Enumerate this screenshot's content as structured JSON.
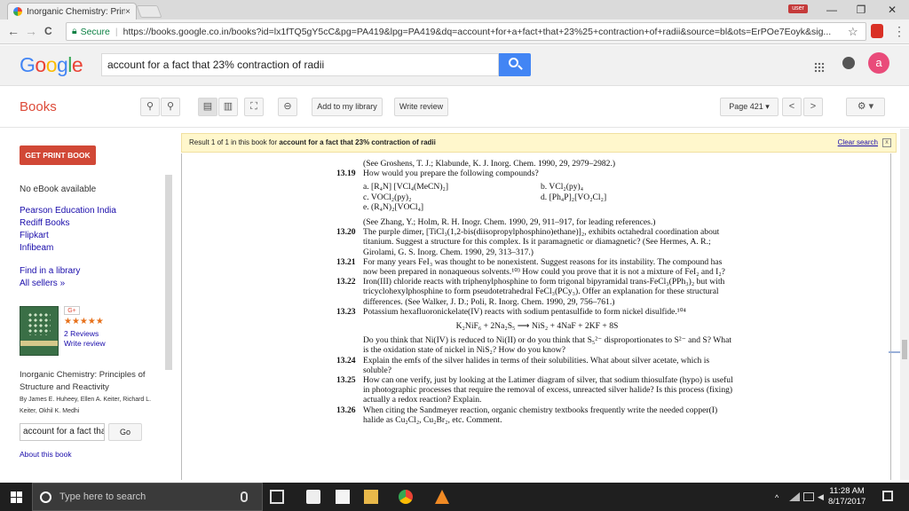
{
  "browser": {
    "tab_title": "Inorganic Chemistry: Prin",
    "tab_close": "×",
    "user_badge": "user",
    "window_controls": {
      "minimize": "—",
      "restore": "❐",
      "close": "✕"
    },
    "secure_label": "Secure",
    "url": "https://books.google.co.in/books?id=lx1fTQ5gY5cC&pg=PA419&lpg=PA419&dq=account+for+a+fact+that+23%25+contraction+of+radii&source=bl&ots=ErPOe7Eoyk&sig...",
    "nav": {
      "back": "←",
      "forward": "→",
      "reload": "C"
    },
    "bookmark_icon": "☆",
    "menu_icon": "⋮"
  },
  "google": {
    "logo_letters": [
      "G",
      "o",
      "o",
      "g",
      "l",
      "e"
    ],
    "logo_colors": [
      "#4285f4",
      "#ea4335",
      "#fbbc05",
      "#4285f4",
      "#34a853",
      "#ea4335"
    ],
    "search_value": "account for a fact that 23% contraction of radii",
    "avatar_letter": "a"
  },
  "books_toolbar": {
    "label": "Books",
    "add_to_library": "Add to my library",
    "write_review": "Write review",
    "page_select": "Page 421 ▾",
    "prev": "<",
    "next": ">",
    "settings": "⚙ ▾"
  },
  "sidebar": {
    "get_print_book": "GET PRINT BOOK",
    "no_ebook": "No eBook available",
    "sellers": [
      "Pearson Education India",
      "Rediff Books",
      "Flipkart",
      "Infibeam"
    ],
    "find_library": "Find in a library",
    "all_sellers": "All sellers »",
    "gplus": "G+",
    "stars": "★★★★★",
    "reviews": "2 Reviews",
    "write_review": "Write review",
    "book_title_1": "Inorganic Chemistry: Principles of",
    "book_title_2": "Structure and Reactivity",
    "authors_1": "By James E. Huheey, Ellen A. Keiter, Richard L.",
    "authors_2": "Keiter, Okhil K. Medhi",
    "search_in_book": "account for a fact tha",
    "go": "Go",
    "about": "About this book"
  },
  "viewer": {
    "result_prefix": "Result 1 of 1 in this book for ",
    "result_query": "account for a fact that 23% contraction of radii",
    "clear_search": "Clear search",
    "clear_x": "x"
  },
  "page": {
    "ref_1": "(See Groshens, T. J.; Klabunde, K. J. Inorg. Chem. 1990, 29, 2979–2982.)",
    "p1319_num": "13.19",
    "p1319": "How would you prepare the following compounds?",
    "parts": [
      "a. [R₄N] [VCl₄(MeCN)₂]",
      "b. VCl₂(py)₄",
      "c. VOCl₂(py)₂",
      "d. [Ph₄P]₂[VO₂Cl₂]",
      "e. (R₄N)₂[VOCl₄]",
      ""
    ],
    "ref_2": "(See Zhang, Y.; Holm, R. H. Inogr. Chem. 1990, 29, 911–917, for leading references.)",
    "p1320_num": "13.20",
    "p1320": "The purple dimer, [TiCl₃(1,2-bis(diisopropylphosphino)ethane)]₂, exhibits octahedral coordination about titanium. Suggest a structure for this complex. Is it paramagnetic or diamagnetic? (See Hermes, A. R.; Girolami, G. S. Inorg. Chem. 1990, 29, 313–317.)",
    "p1321_num": "13.21",
    "p1321": "For many years FeI₃ was thought to be nonexistent. Suggest reasons for its instability. The compound has now been prepared in nonaqueous solvents.¹⁰³ How could you prove that it is not a mixture of FeI₂ and I₂?",
    "p1322_num": "13.22",
    "p1322": "Iron(III) chloride reacts with triphenylphosphine to form trigonal bipyramidal trans-FeCl₃(PPh₃)₂ but with tricyclohexylphosphine to form pseudotetrahedral FeCl₃(PCy₃). Offer an explanation for these structural differences. (See Walker, J. D.; Poli, R. Inorg. Chem. 1990, 29, 756–761.)",
    "p1323_num": "13.23",
    "p1323": "Potassium hexafluoronickelate(IV) reacts with sodium pentasulfide to form nickel disulfide.¹⁰⁴",
    "equation": "K₂NiF₆ + 2Na₂S₅ ⟶ NiS₂ + 4NaF + 2KF + 8S",
    "p1323b": "Do you think that Ni(IV) is reduced to Ni(II) or do you think that S₅²⁻ disproportionates to S²⁻ and S? What is the oxidation state of nickel in NiS₂? How do you know?",
    "p1324_num": "13.24",
    "p1324": "Explain the emfs of the silver halides in terms of their solubilities. What about silver acetate, which is soluble?",
    "p1325_num": "13.25",
    "p1325": "How can one verify, just by looking at the Latimer diagram of silver, that sodium thiosulfate (hypo) is useful in photographic processes that require the removal of excess, unreacted silver halide? Is this process (fixing) actually a redox reaction? Explain.",
    "p1326_num": "13.26",
    "p1326": "When citing the Sandmeyer reaction, organic chemistry textbooks frequently write the needed copper(I) halide as Cu₂Cl₂, Cu₂Br₂, etc. Comment."
  },
  "taskbar": {
    "search_placeholder": "Type here to search",
    "time": "11:28 AM",
    "date": "8/17/2017"
  }
}
